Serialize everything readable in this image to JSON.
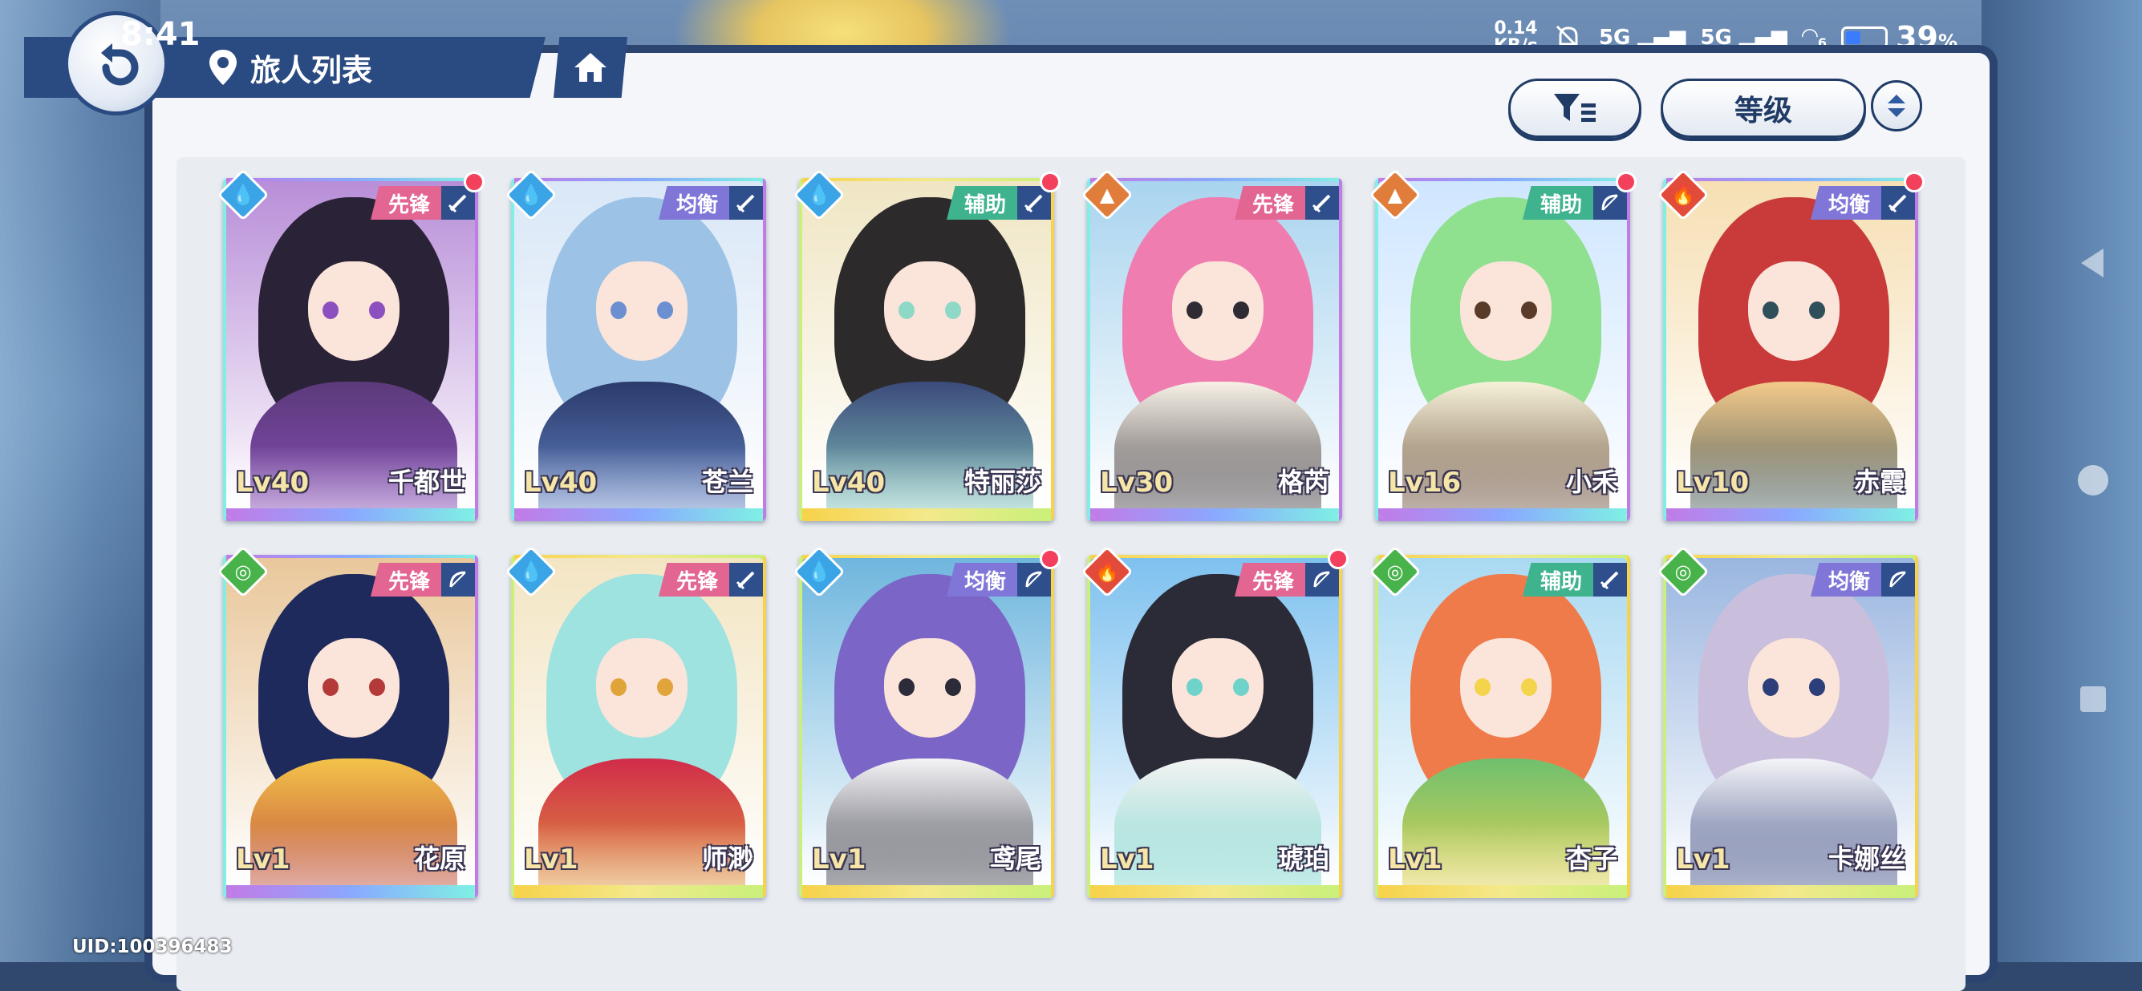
{
  "status_bar": {
    "time": "8:41",
    "network_speed": "0.14",
    "network_unit": "KB/s",
    "sim1": "5G",
    "sim2": "5G",
    "wifi_badge": "6",
    "battery_percent": "39",
    "battery_unit": "%",
    "battery_level": 0.39
  },
  "header": {
    "title": "旅人列表",
    "back_icon": "back-arrow-icon",
    "location_icon": "location-pin-icon",
    "home_icon": "home-icon"
  },
  "toolbar": {
    "filter_icon": "filter-icon",
    "sort_label": "等级",
    "order_icon": "sort-order-icon"
  },
  "colors": {
    "accent_navy": "#2a4a82",
    "new_dot": "#f2405d",
    "role_vanguard": "#e26592",
    "role_balance": "#7f76d8",
    "role_support": "#3fb28e",
    "elem_water": "#3aa4e6",
    "elem_earth": "#e07d3a",
    "elem_fire": "#e24a3a",
    "elem_wind": "#49b34b"
  },
  "characters": [
    {
      "name": "千都世",
      "level": "Lv40",
      "role": "先锋",
      "element": "water",
      "weapon": "sword-icon",
      "new": true,
      "rarity": "purple",
      "palette": [
        "#2a2236",
        "#8c4fbf",
        "#5b3a7a",
        "#b88ed8"
      ]
    },
    {
      "name": "苍兰",
      "level": "Lv40",
      "role": "均衡",
      "element": "water",
      "weapon": "sword-icon",
      "new": false,
      "rarity": "purple",
      "palette": [
        "#9cc2e6",
        "#6b8fd1",
        "#2b3a6b",
        "#d9e7f7"
      ]
    },
    {
      "name": "特丽莎",
      "level": "Lv40",
      "role": "辅助",
      "element": "water",
      "weapon": "sword-icon",
      "new": true,
      "rarity": "gold",
      "palette": [
        "#2c2a2a",
        "#8ed8c6",
        "#3b4a7a",
        "#f0e6c4"
      ]
    },
    {
      "name": "格芮",
      "level": "Lv30",
      "role": "先锋",
      "element": "earth",
      "weapon": "sword-icon",
      "new": false,
      "rarity": "purple",
      "palette": [
        "#f07db0",
        "#2e2b33",
        "#f7f1e6",
        "#a9d4ef"
      ]
    },
    {
      "name": "小禾",
      "level": "Lv16",
      "role": "辅助",
      "element": "earth",
      "weapon": "bow-icon",
      "new": true,
      "rarity": "purple",
      "palette": [
        "#8fe08f",
        "#5a3b2a",
        "#f6f2d9",
        "#cfe6ff"
      ]
    },
    {
      "name": "赤霞",
      "level": "Lv10",
      "role": "均衡",
      "element": "fire",
      "weapon": "sword-icon",
      "new": true,
      "rarity": "purple",
      "palette": [
        "#c93b3b",
        "#2f4f5b",
        "#f4c98a",
        "#f6dfb3"
      ]
    },
    {
      "name": "花原",
      "level": "Lv1",
      "role": "先锋",
      "element": "wind",
      "weapon": "bow-icon",
      "new": false,
      "rarity": "purple",
      "palette": [
        "#1f2a5c",
        "#b43a3a",
        "#f4c34a",
        "#e9c79b"
      ]
    },
    {
      "name": "师渺",
      "level": "Lv1",
      "role": "先锋",
      "element": "water",
      "weapon": "sword-icon",
      "new": false,
      "rarity": "gold",
      "palette": [
        "#9fe3e0",
        "#e0a43a",
        "#d12c4a",
        "#f3e5c3"
      ]
    },
    {
      "name": "鸢尾",
      "level": "Lv1",
      "role": "均衡",
      "element": "water",
      "weapon": "bow-icon",
      "new": true,
      "rarity": "gold",
      "palette": [
        "#7b66c7",
        "#2b2b3a",
        "#f4f4f6",
        "#6fb6de"
      ]
    },
    {
      "name": "琥珀",
      "level": "Lv1",
      "role": "先锋",
      "element": "fire",
      "weapon": "bow-icon",
      "new": true,
      "rarity": "gold",
      "palette": [
        "#2b2b38",
        "#6fd3c9",
        "#f3f3f3",
        "#7ec1ef"
      ]
    },
    {
      "name": "杏子",
      "level": "Lv1",
      "role": "辅助",
      "element": "wind",
      "weapon": "sword-icon",
      "new": false,
      "rarity": "gold",
      "palette": [
        "#ef7b4a",
        "#f4d44a",
        "#6fc06f",
        "#a9d9f2"
      ]
    },
    {
      "name": "卡娜丝",
      "level": "Lv1",
      "role": "均衡",
      "element": "wind",
      "weapon": "bow-icon",
      "new": false,
      "rarity": "gold",
      "palette": [
        "#c9bfdc",
        "#2d3f7a",
        "#f4f4f8",
        "#9ab6e0"
      ]
    }
  ],
  "uid_label": "UID:100396483"
}
